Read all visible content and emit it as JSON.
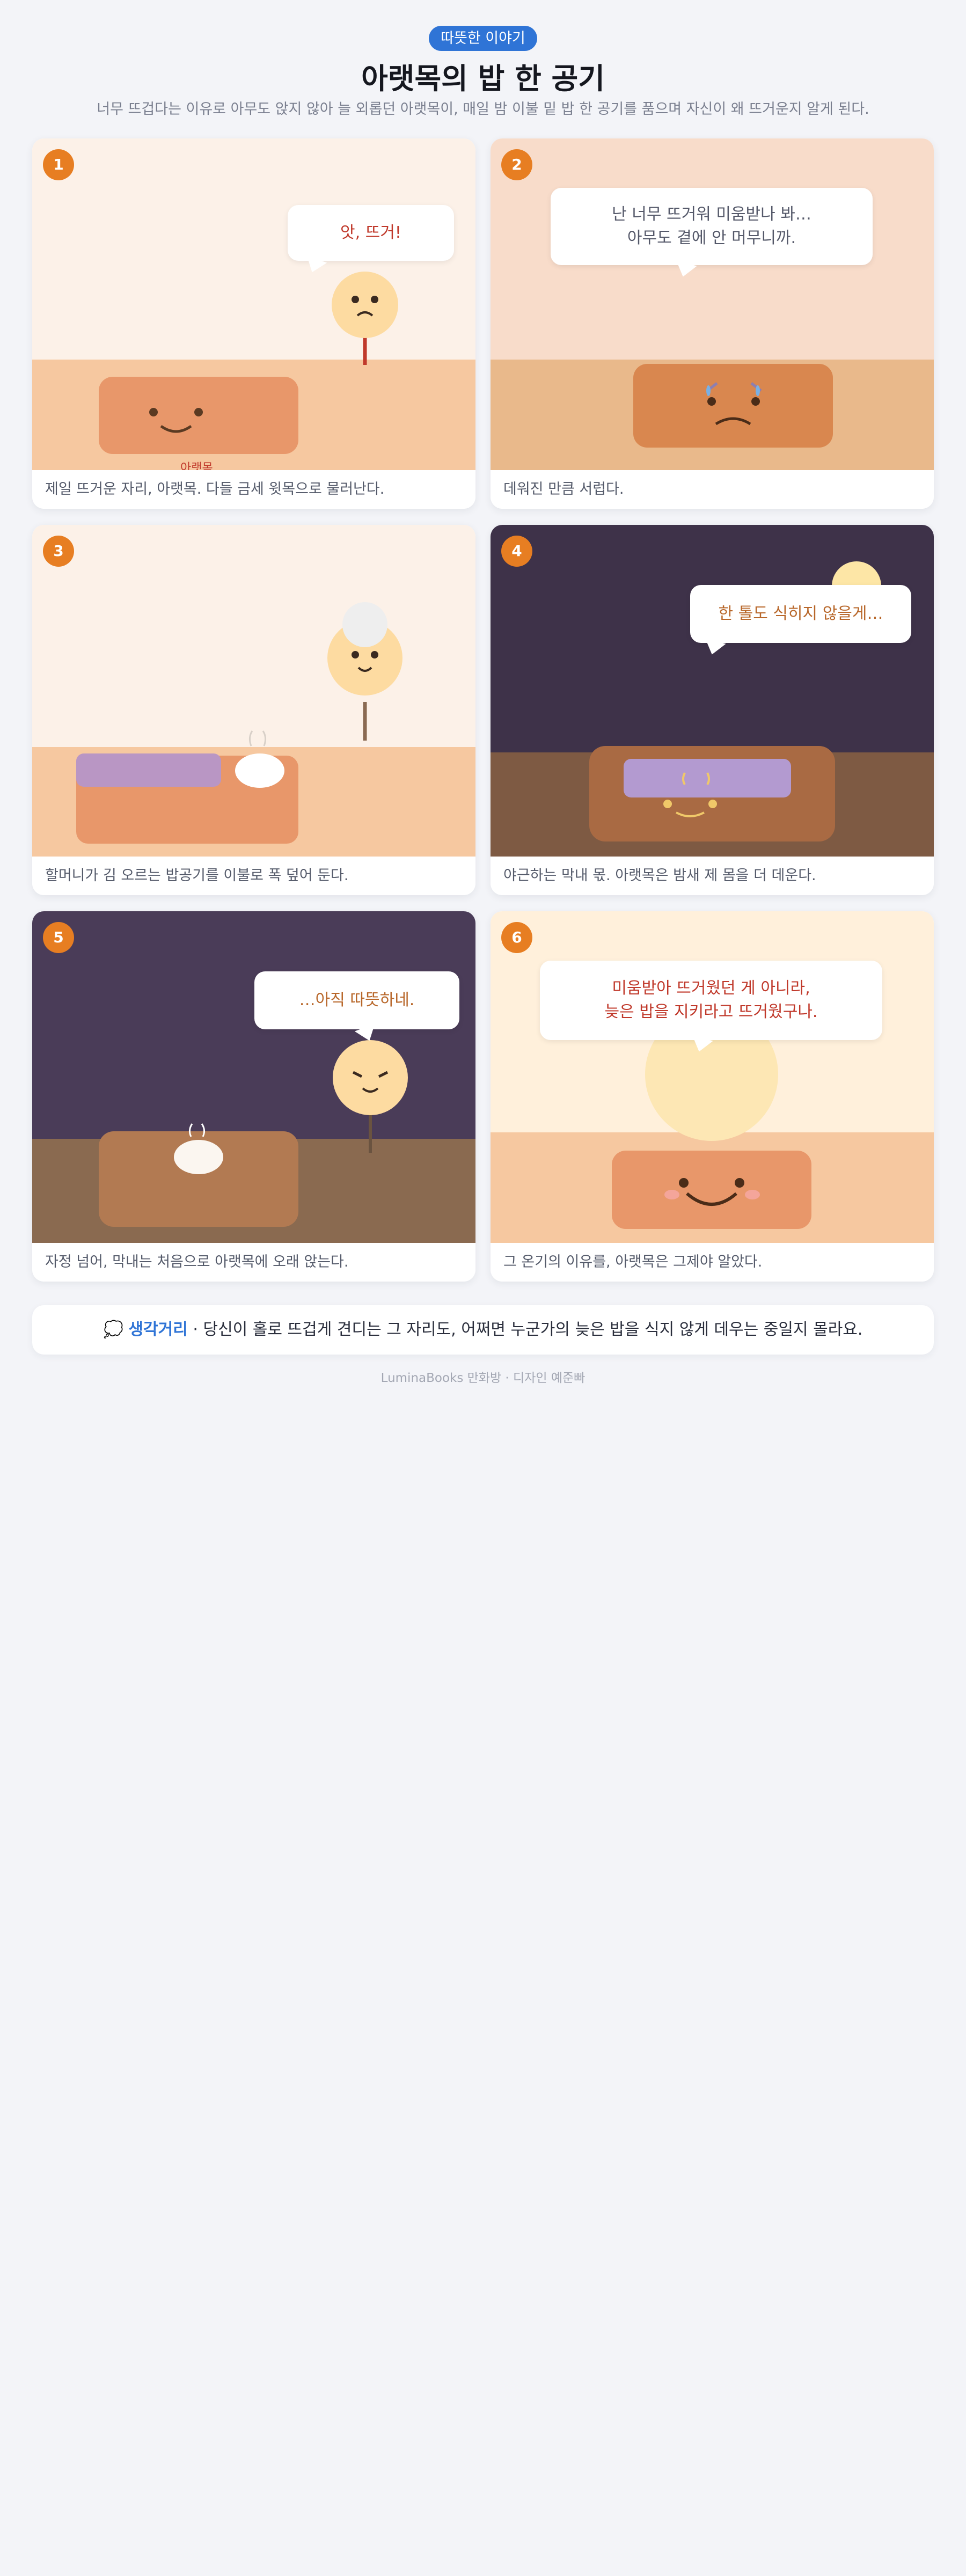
{
  "header": {
    "tag": "따뜻한 이야기",
    "title": "아랫목의 밥 한 공기",
    "subtitle": "너무 뜨겁다는 이유로 아무도 앉지 않아 늘 외롭던 아랫목이, 매일 밤 이불 밑 밥 한 공기를 품으며 자신이 왜 뜨거운지 알게 된다."
  },
  "panels": [
    {
      "number": "1",
      "bubble_lines": [
        "앗, 뜨거!"
      ],
      "name_label": "아랫목",
      "caption": "제일 뜨거운 자리, 아랫목. 다들 금세 윗목으로 물러난다."
    },
    {
      "number": "2",
      "bubble_lines": [
        "난 너무 뜨거워 미움받나 봐…",
        "아무도 곁에 안 머무니까."
      ],
      "caption": "데워진 만큼 서럽다."
    },
    {
      "number": "3",
      "caption": "할머니가 김 오르는 밥공기를 이불로 폭 덮어 둔다."
    },
    {
      "number": "4",
      "bubble_lines": [
        "한 톨도 식히지 않을게…"
      ],
      "caption": "야근하는 막내 몫. 아랫목은 밤새 제 몸을 더 데운다."
    },
    {
      "number": "5",
      "bubble_lines": [
        "…아직 따뜻하네."
      ],
      "caption": "자정 넘어, 막내는 처음으로 아랫목에 오래 앉는다."
    },
    {
      "number": "6",
      "bubble_lines": [
        "미움받아 뜨거웠던 게 아니라,",
        "늦은 밥을 지키라고 뜨거웠구나."
      ],
      "caption": "그 온기의 이유를, 아랫목은 그제야 알았다."
    }
  ],
  "thought": {
    "icon": "speech-balloon-icon",
    "label": "생각거리",
    "separator": " · ",
    "text": "당신이 홀로 뜨겁게 견디는 그 자리도, 어쩌면 누군가의 늦은 밥을 식지 않게 데우는 중일지 몰라요."
  },
  "footer": "LuminaBooks 만화방 · 디자인 예준빠",
  "colors": {
    "accent": "#2f74d6",
    "badge": "#e77e22",
    "bubble_text_red": "#c0392b",
    "bubble_text_gray": "#55596a",
    "bubble_text_orange": "#b8672a"
  }
}
